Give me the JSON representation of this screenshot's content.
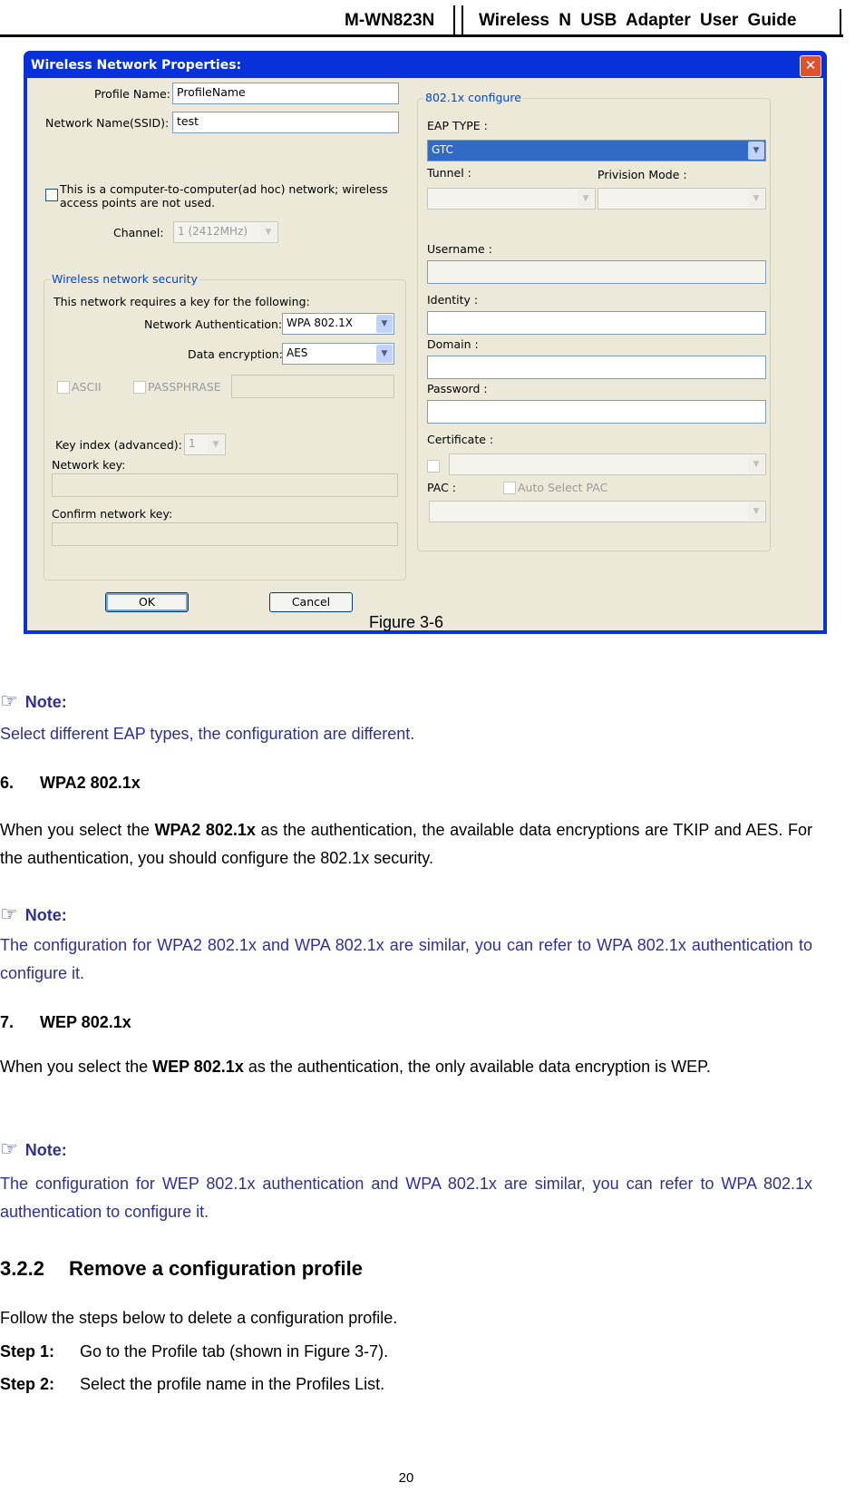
{
  "header": {
    "model": "M-WN823N",
    "guide": "Wireless  N  USB  Adapter  User  Guide"
  },
  "dialog": {
    "title": "Wireless Network Properties:",
    "close_glyph": "✕",
    "profile_name_label": "Profile Name:",
    "profile_name_value": "ProfileName",
    "ssid_label": "Network Name(SSID):",
    "ssid_value": "test",
    "adhoc_label_1": "This is a computer-to-computer(ad hoc) network; wireless",
    "adhoc_label_2": "access points are not used.",
    "channel_label": "Channel:",
    "channel_value": "1  (2412MHz)",
    "security": {
      "legend": "Wireless network security",
      "requires": "This network requires a key for the following:",
      "auth_label": "Network Authentication:",
      "auth_value": "WPA 802.1X",
      "enc_label": "Data encryption:",
      "enc_value": "AES",
      "ascii_label": "ASCII",
      "passphrase_label": "PASSPHRASE",
      "key_index_label": "Key index (advanced):",
      "key_index_value": "1",
      "network_key_label": "Network key:",
      "confirm_key_label": "Confirm network key:"
    },
    "dot1x": {
      "legend": "802.1x configure",
      "eap_type_label": "EAP TYPE :",
      "eap_type_value": "GTC",
      "tunnel_label": "Tunnel :",
      "provision_label": "Privision Mode :",
      "username_label": "Username :",
      "identity_label": "Identity :",
      "domain_label": "Domain :",
      "password_label": "Password :",
      "certificate_label": "Certificate :",
      "pac_label": "PAC :",
      "auto_pac_label": "Auto Select PAC"
    },
    "ok_label": "OK",
    "cancel_label": "Cancel",
    "dropdown_glyph": "▼"
  },
  "caption": "Figure 3-6",
  "note_icon": "☞",
  "note_label": "Note:",
  "note1": "Select different EAP types, the configuration are different.",
  "section6": {
    "num": "6.",
    "title": "WPA2 802.1x"
  },
  "para6": {
    "pre": "When you select the ",
    "bold": "WPA2 802.1x",
    "post": " as the authentication, the available data encryptions are TKIP and AES. For the authentication, you should configure the 802.1x security."
  },
  "note2": "The configuration for WPA2 802.1x and WPA 802.1x are similar, you can refer to WPA 802.1x authentication to configure it.",
  "section7": {
    "num": "7.",
    "title": "WEP 802.1x"
  },
  "para7": {
    "pre": "When you select the ",
    "bold": "WEP 802.1x",
    "post": " as the authentication, the only available data encryption is WEP."
  },
  "note3": "The configuration for WEP 802.1x authentication and WPA 802.1x are similar, you can refer to WPA 802.1x authentication to configure it.",
  "heading322": {
    "num": "3.2.2",
    "title": "Remove a configuration profile"
  },
  "intro": "Follow the steps below to delete a configuration profile.",
  "step1": {
    "label": "Step 1:",
    "text": "Go to the Profile tab (shown in Figure 3-7)."
  },
  "step2": {
    "label": "Step 2:",
    "text": "Select the profile name in the Profiles List."
  },
  "page_number": "20"
}
